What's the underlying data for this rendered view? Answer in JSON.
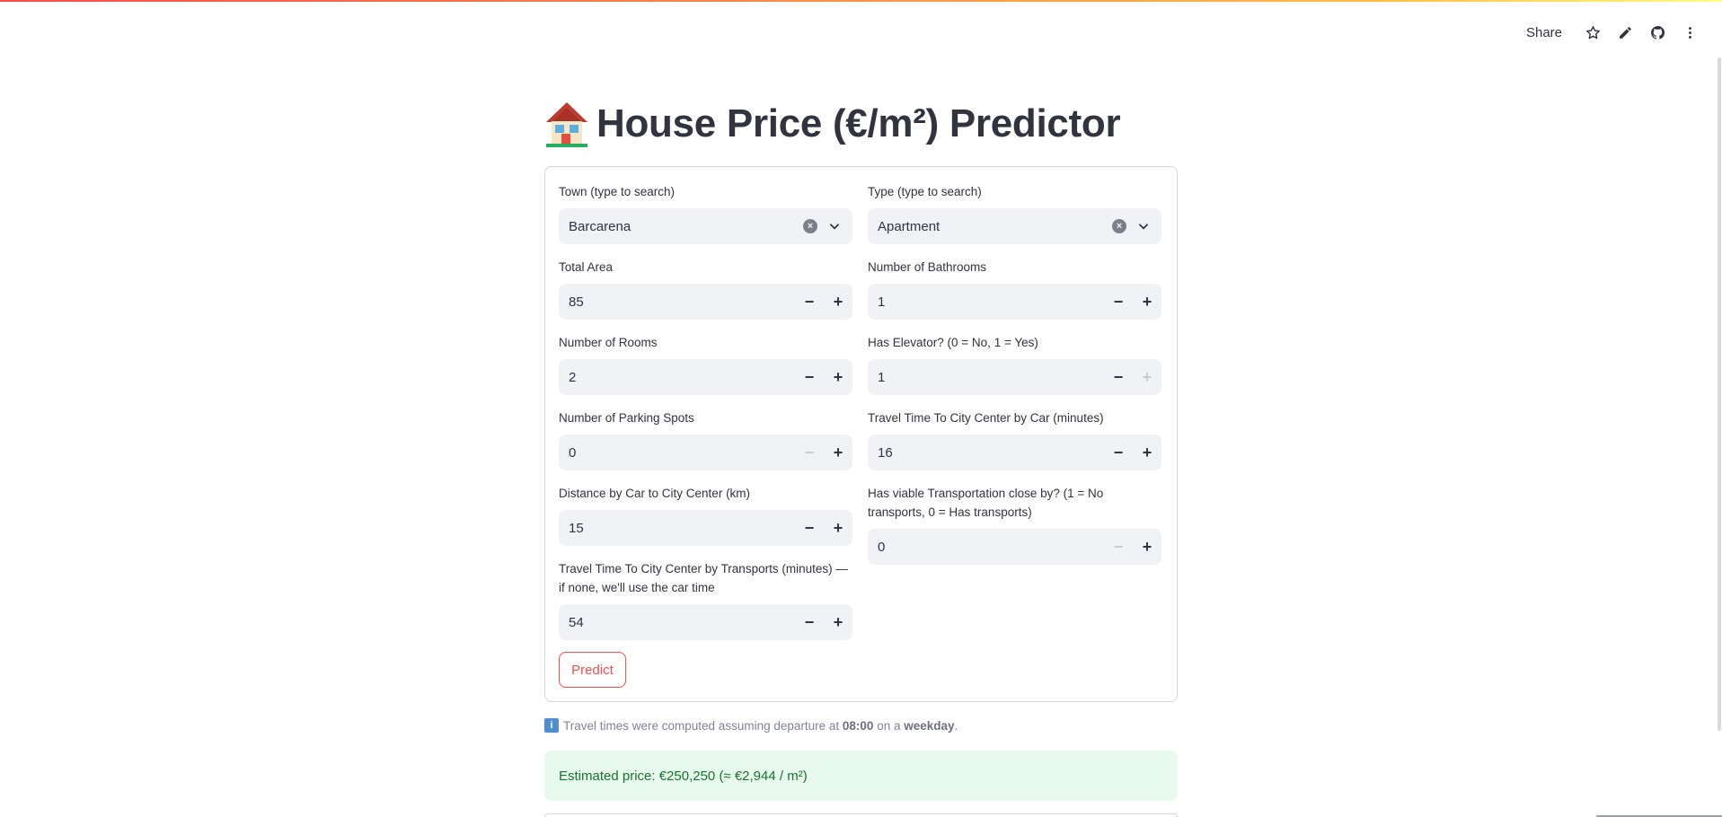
{
  "header": {
    "share_label": "Share",
    "icons": [
      "star-icon",
      "pencil-icon",
      "github-icon",
      "more-vertical-icon"
    ]
  },
  "title": {
    "emoji": "house-emoji",
    "text": "House Price (€/m²) Predictor"
  },
  "form": {
    "town": {
      "label": "Town (type to search)",
      "value": "Barcarena"
    },
    "type": {
      "label": "Type (type to search)",
      "value": "Apartment"
    },
    "total_area": {
      "label": "Total Area",
      "value": "85"
    },
    "bathrooms": {
      "label": "Number of Bathrooms",
      "value": "1"
    },
    "rooms": {
      "label": "Number of Rooms",
      "value": "2"
    },
    "elevator": {
      "label": "Has Elevator? (0 = No, 1 = Yes)",
      "value": "1"
    },
    "parking": {
      "label": "Number of Parking Spots",
      "value": "0"
    },
    "car_time": {
      "label": "Travel Time To City Center by Car (minutes)",
      "value": "16"
    },
    "distance": {
      "label": "Distance by Car to City Center (km)",
      "value": "15"
    },
    "transport_available": {
      "label": "Has viable Transportation close by? (1 = No transports, 0 = Has transports)",
      "value": "0"
    },
    "transport_time": {
      "label": "Travel Time To City Center by Transports (minutes) — if none, we'll use the car time",
      "value": "54"
    },
    "predict_label": "Predict",
    "minus": "−",
    "plus": "+",
    "clear": "×"
  },
  "note": {
    "icon": "i",
    "prefix": "Travel times were computed assuming departure at",
    "time": "08:00",
    "middle": "on a",
    "day": "weekday",
    "suffix": "."
  },
  "result": {
    "text": "Estimated price: €250,250 (≈ €2,944 / m²)"
  },
  "colors": {
    "accent": "#ff4b4b",
    "input_bg": "#f0f2f6",
    "success_bg": "#e8f9ee",
    "success_text": "#177233"
  }
}
